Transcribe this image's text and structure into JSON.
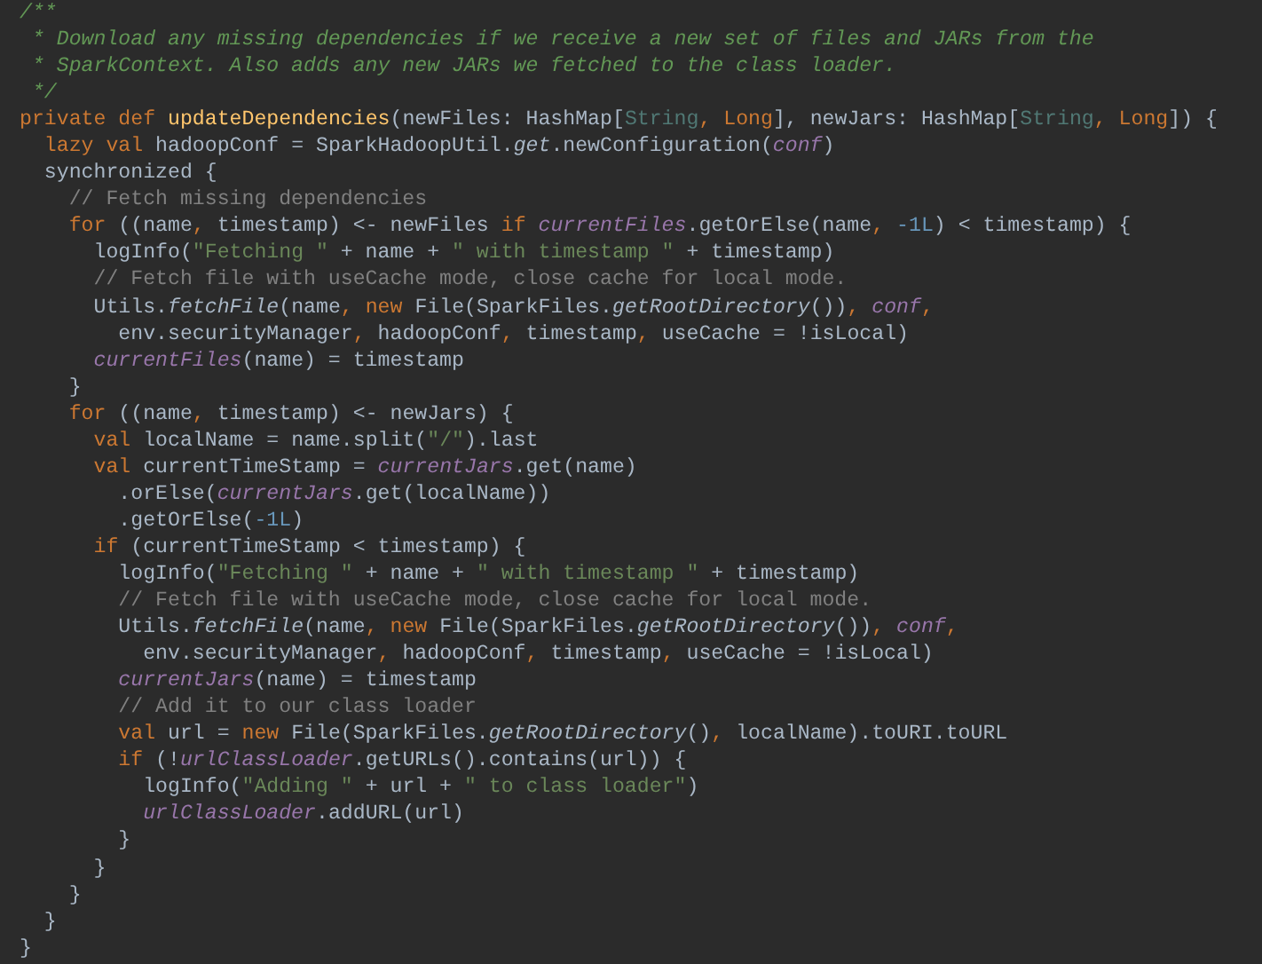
{
  "editor": {
    "lines": [
      {
        "tokens": [
          {
            "text": "/**",
            "kind": "doc"
          }
        ]
      },
      {
        "tokens": [
          {
            "text": " * Download any missing dependencies if we receive a new set of files and JARs from the",
            "kind": "doc"
          }
        ]
      },
      {
        "tokens": [
          {
            "text": " * SparkContext. Also adds any new JARs we fetched to the class loader.",
            "kind": "doc"
          }
        ]
      },
      {
        "tokens": [
          {
            "text": " */",
            "kind": "doc"
          }
        ]
      },
      {
        "tokens": [
          {
            "text": "private def ",
            "kind": "keyword"
          },
          {
            "text": "updateDependencies",
            "kind": "declaration"
          },
          {
            "text": "(newFiles: HashMap[",
            "kind": "plain"
          },
          {
            "text": "String",
            "kind": "type"
          },
          {
            "text": ",",
            "kind": "punct"
          },
          {
            "text": " Long",
            "kind": "keyword"
          },
          {
            "text": "], newJars: HashMap[",
            "kind": "plain"
          },
          {
            "text": "String",
            "kind": "type"
          },
          {
            "text": ",",
            "kind": "punct"
          },
          {
            "text": " Long",
            "kind": "keyword"
          },
          {
            "text": "]) {",
            "kind": "plain"
          }
        ]
      },
      {
        "tokens": [
          {
            "text": "  lazy val",
            "kind": "keyword"
          },
          {
            "text": " hadoopConf = SparkHadoopUtil.",
            "kind": "plain"
          },
          {
            "text": "get",
            "kind": "italic"
          },
          {
            "text": ".newConfiguration(",
            "kind": "plain"
          },
          {
            "text": "conf",
            "kind": "field"
          },
          {
            "text": ")",
            "kind": "plain"
          }
        ]
      },
      {
        "tokens": [
          {
            "text": "  synchronized {",
            "kind": "plain"
          }
        ]
      },
      {
        "tokens": [
          {
            "text": "    // Fetch missing dependencies",
            "kind": "comment"
          }
        ]
      },
      {
        "tokens": [
          {
            "text": "    for",
            "kind": "keyword"
          },
          {
            "text": " ((name",
            "kind": "plain"
          },
          {
            "text": ",",
            "kind": "punct"
          },
          {
            "text": " timestamp) <- newFiles ",
            "kind": "plain"
          },
          {
            "text": "if",
            "kind": "keyword"
          },
          {
            "text": " currentFiles",
            "kind": "field"
          },
          {
            "text": ".getOrElse(name",
            "kind": "plain"
          },
          {
            "text": ",",
            "kind": "punct"
          },
          {
            "text": " -1L",
            "kind": "number"
          },
          {
            "text": ") < timestamp) {",
            "kind": "plain"
          }
        ]
      },
      {
        "tokens": [
          {
            "text": "      logInfo(",
            "kind": "plain"
          },
          {
            "text": "\"Fetching \"",
            "kind": "string"
          },
          {
            "text": " + name + ",
            "kind": "plain"
          },
          {
            "text": "\" with timestamp \"",
            "kind": "string"
          },
          {
            "text": " + timestamp)",
            "kind": "plain"
          }
        ]
      },
      {
        "tokens": [
          {
            "text": "      // Fetch file with useCache mode, close cache for local mode.",
            "kind": "comment"
          }
        ]
      },
      {
        "tokens": [
          {
            "text": "      Utils.",
            "kind": "plain"
          },
          {
            "text": "fetchFile",
            "kind": "italic"
          },
          {
            "text": "(name",
            "kind": "plain"
          },
          {
            "text": ",",
            "kind": "punct"
          },
          {
            "text": " new",
            "kind": "keyword"
          },
          {
            "text": " File(SparkFiles.",
            "kind": "plain"
          },
          {
            "text": "getRootDirectory",
            "kind": "italic"
          },
          {
            "text": "())",
            "kind": "plain"
          },
          {
            "text": ",",
            "kind": "punct"
          },
          {
            "text": " conf",
            "kind": "field"
          },
          {
            "text": ",",
            "kind": "punct"
          }
        ]
      },
      {
        "tokens": [
          {
            "text": "        env.securityManager",
            "kind": "plain"
          },
          {
            "text": ",",
            "kind": "punct"
          },
          {
            "text": " hadoopConf",
            "kind": "plain"
          },
          {
            "text": ",",
            "kind": "punct"
          },
          {
            "text": " timestamp",
            "kind": "plain"
          },
          {
            "text": ",",
            "kind": "punct"
          },
          {
            "text": " useCache = !isLocal)",
            "kind": "plain"
          }
        ]
      },
      {
        "tokens": [
          {
            "text": "      currentFiles",
            "kind": "field"
          },
          {
            "text": "(name) = timestamp",
            "kind": "plain"
          }
        ]
      },
      {
        "tokens": [
          {
            "text": "    }",
            "kind": "plain"
          }
        ]
      },
      {
        "tokens": [
          {
            "text": "    for",
            "kind": "keyword"
          },
          {
            "text": " ((name",
            "kind": "plain"
          },
          {
            "text": ",",
            "kind": "punct"
          },
          {
            "text": " timestamp) <- newJars) {",
            "kind": "plain"
          }
        ]
      },
      {
        "tokens": [
          {
            "text": "      val",
            "kind": "keyword"
          },
          {
            "text": " localName = name.split(",
            "kind": "plain"
          },
          {
            "text": "\"/\"",
            "kind": "string"
          },
          {
            "text": ").last",
            "kind": "plain"
          }
        ]
      },
      {
        "tokens": [
          {
            "text": "      val",
            "kind": "keyword"
          },
          {
            "text": " currentTimeStamp = ",
            "kind": "plain"
          },
          {
            "text": "currentJars",
            "kind": "field"
          },
          {
            "text": ".get(name)",
            "kind": "plain"
          }
        ]
      },
      {
        "tokens": [
          {
            "text": "        .orElse(",
            "kind": "plain"
          },
          {
            "text": "currentJars",
            "kind": "field"
          },
          {
            "text": ".get(localName))",
            "kind": "plain"
          }
        ]
      },
      {
        "tokens": [
          {
            "text": "        .getOrElse(",
            "kind": "plain"
          },
          {
            "text": "-1L",
            "kind": "number"
          },
          {
            "text": ")",
            "kind": "plain"
          }
        ]
      },
      {
        "tokens": [
          {
            "text": "      if",
            "kind": "keyword"
          },
          {
            "text": " (currentTimeStamp < timestamp) {",
            "kind": "plain"
          }
        ]
      },
      {
        "tokens": [
          {
            "text": "        logInfo(",
            "kind": "plain"
          },
          {
            "text": "\"Fetching \"",
            "kind": "string"
          },
          {
            "text": " + name + ",
            "kind": "plain"
          },
          {
            "text": "\" with timestamp \"",
            "kind": "string"
          },
          {
            "text": " + timestamp)",
            "kind": "plain"
          }
        ]
      },
      {
        "tokens": [
          {
            "text": "        // Fetch file with useCache mode, close cache for local mode.",
            "kind": "comment"
          }
        ]
      },
      {
        "tokens": [
          {
            "text": "        Utils.",
            "kind": "plain"
          },
          {
            "text": "fetchFile",
            "kind": "italic"
          },
          {
            "text": "(name",
            "kind": "plain"
          },
          {
            "text": ",",
            "kind": "punct"
          },
          {
            "text": " new",
            "kind": "keyword"
          },
          {
            "text": " File(SparkFiles.",
            "kind": "plain"
          },
          {
            "text": "getRootDirectory",
            "kind": "italic"
          },
          {
            "text": "())",
            "kind": "plain"
          },
          {
            "text": ",",
            "kind": "punct"
          },
          {
            "text": " conf",
            "kind": "field"
          },
          {
            "text": ",",
            "kind": "punct"
          }
        ]
      },
      {
        "tokens": [
          {
            "text": "          env.securityManager",
            "kind": "plain"
          },
          {
            "text": ",",
            "kind": "punct"
          },
          {
            "text": " hadoopConf",
            "kind": "plain"
          },
          {
            "text": ",",
            "kind": "punct"
          },
          {
            "text": " timestamp",
            "kind": "plain"
          },
          {
            "text": ",",
            "kind": "punct"
          },
          {
            "text": " useCache = !isLocal)",
            "kind": "plain"
          }
        ]
      },
      {
        "tokens": [
          {
            "text": "        currentJars",
            "kind": "field"
          },
          {
            "text": "(name) = timestamp",
            "kind": "plain"
          }
        ]
      },
      {
        "tokens": [
          {
            "text": "        // Add it to our class loader",
            "kind": "comment"
          }
        ]
      },
      {
        "tokens": [
          {
            "text": "        val",
            "kind": "keyword"
          },
          {
            "text": " url = ",
            "kind": "plain"
          },
          {
            "text": "new",
            "kind": "keyword"
          },
          {
            "text": " File(SparkFiles.",
            "kind": "plain"
          },
          {
            "text": "getRootDirectory",
            "kind": "italic"
          },
          {
            "text": "()",
            "kind": "plain"
          },
          {
            "text": ",",
            "kind": "punct"
          },
          {
            "text": " localName).toURI.toURL",
            "kind": "plain"
          }
        ]
      },
      {
        "tokens": [
          {
            "text": "        if",
            "kind": "keyword"
          },
          {
            "text": " (!",
            "kind": "plain"
          },
          {
            "text": "urlClassLoader",
            "kind": "field"
          },
          {
            "text": ".getURLs().contains(url)) {",
            "kind": "plain"
          }
        ]
      },
      {
        "tokens": [
          {
            "text": "          logInfo(",
            "kind": "plain"
          },
          {
            "text": "\"Adding \"",
            "kind": "string"
          },
          {
            "text": " + url + ",
            "kind": "plain"
          },
          {
            "text": "\" to class loader\"",
            "kind": "string"
          },
          {
            "text": ")",
            "kind": "plain"
          }
        ]
      },
      {
        "tokens": [
          {
            "text": "          urlClassLoader",
            "kind": "field"
          },
          {
            "text": ".addURL(url)",
            "kind": "plain"
          }
        ]
      },
      {
        "tokens": [
          {
            "text": "        }",
            "kind": "plain"
          }
        ]
      },
      {
        "tokens": [
          {
            "text": "      }",
            "kind": "plain"
          }
        ]
      },
      {
        "tokens": [
          {
            "text": "    }",
            "kind": "plain"
          }
        ]
      },
      {
        "tokens": [
          {
            "text": "  }",
            "kind": "plain"
          }
        ]
      },
      {
        "tokens": [
          {
            "text": "}",
            "kind": "plain"
          }
        ]
      }
    ]
  }
}
